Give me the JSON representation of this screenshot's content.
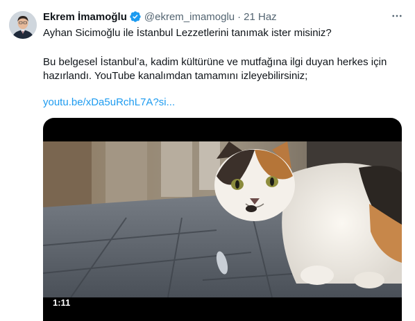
{
  "tweet": {
    "author_name": "Ekrem İmamoğlu",
    "handle": "@ekrem_imamoglu",
    "separator": "·",
    "timestamp": "21 Haz",
    "verified_icon": "verified-badge-icon",
    "more_icon": "more-options-icon",
    "text_line1": "Ayhan Sicimoğlu ile İstanbul Lezzetlerini tanımak ister misiniz?",
    "text_paragraph2": "Bu belgesel İstanbul’a, kadim kültürüne ve mutfağına ilgi duyan herkes için hazırlandı. YouTube kanalımdan tamamını izleyebilirsiniz;",
    "link_text": "youtu.be/xDa5uRchL7A?si...",
    "colors": {
      "link": "#1d9bf0",
      "verified": "#1d9bf0",
      "secondary_text": "#536471"
    }
  },
  "video": {
    "duration": "1:11"
  }
}
